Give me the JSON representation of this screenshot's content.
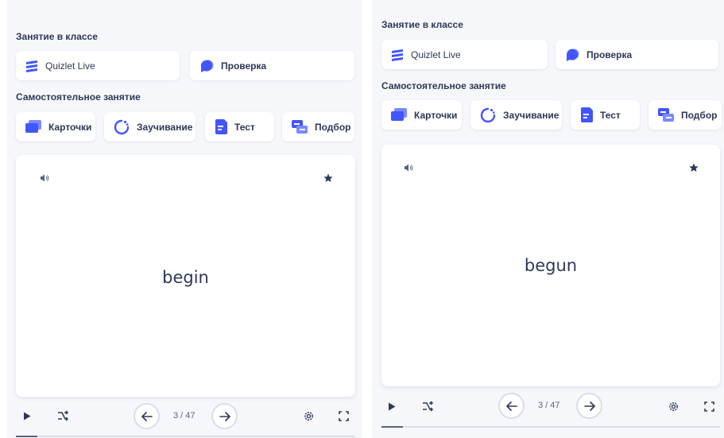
{
  "colors": {
    "accent": "#4255ff",
    "text": "#2e3856",
    "muted": "#586380",
    "pane_bg": "#f6f7fb",
    "card_bg": "#ffffff"
  },
  "panes": [
    {
      "in_class_title": "Занятие в классе",
      "in_class_modes": [
        {
          "label": "Quizlet Live",
          "icon": "quizlet-live-icon"
        },
        {
          "label": "Проверка",
          "icon": "checkpoint-icon"
        }
      ],
      "self_study_title": "Самостоятельное занятие",
      "self_study_modes": [
        {
          "label": "Карточки",
          "icon": "flashcards-icon"
        },
        {
          "label": "Заучивание",
          "icon": "learn-icon"
        },
        {
          "label": "Тест",
          "icon": "test-icon"
        },
        {
          "label": "Подбор",
          "icon": "match-icon"
        }
      ],
      "card": {
        "term": "begin",
        "audio_icon": "speaker-icon",
        "star_icon": "star-icon"
      },
      "controls": {
        "counter": "3 / 47",
        "progress": 0.064
      }
    },
    {
      "in_class_title": "Занятие в классе",
      "in_class_modes": [
        {
          "label": "Quizlet Live",
          "icon": "quizlet-live-icon"
        },
        {
          "label": "Проверка",
          "icon": "checkpoint-icon"
        }
      ],
      "self_study_title": "Самостоятельное занятие",
      "self_study_modes": [
        {
          "label": "Карточки",
          "icon": "flashcards-icon"
        },
        {
          "label": "Заучивание",
          "icon": "learn-icon"
        },
        {
          "label": "Тест",
          "icon": "test-icon"
        },
        {
          "label": "Подбор",
          "icon": "match-icon"
        }
      ],
      "card": {
        "term": "begun",
        "audio_icon": "speaker-icon",
        "star_icon": "star-icon"
      },
      "controls": {
        "counter": "3 / 47",
        "progress": 0.064
      }
    }
  ]
}
